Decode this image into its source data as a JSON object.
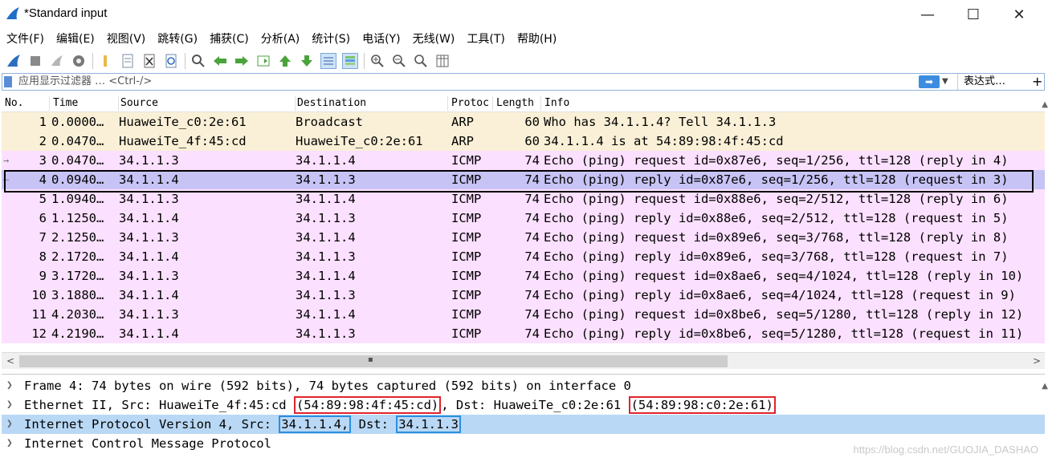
{
  "window": {
    "title": "*Standard input",
    "minimize": "—",
    "maximize": "☐",
    "close": "✕"
  },
  "menu": [
    "文件(F)",
    "编辑(E)",
    "视图(V)",
    "跳转(G)",
    "捕获(C)",
    "分析(A)",
    "统计(S)",
    "电话(Y)",
    "无线(W)",
    "工具(T)",
    "帮助(H)"
  ],
  "filter": {
    "placeholder": "应用显示过滤器 … <Ctrl-/>",
    "expression_label": "表达式…",
    "plus": "+"
  },
  "columns": {
    "no": "No.",
    "time": "Time",
    "source": "Source",
    "destination": "Destination",
    "protocol": "Protoc",
    "length": "Length",
    "info": "Info"
  },
  "colors": {
    "arp_row": "#faf0d7",
    "icmp_row": "#fce0ff",
    "selected_row": "#c7c3f5",
    "highlight_red": "#e0242b",
    "highlight_blue": "#2b8fde"
  },
  "packets": [
    {
      "no": "1",
      "time": "0.0000…",
      "src": "HuaweiTe_c0:2e:61",
      "dst": "Broadcast",
      "proto": "ARP",
      "len": "60",
      "info": "Who has 34.1.1.4? Tell 34.1.1.3",
      "marker": ""
    },
    {
      "no": "2",
      "time": "0.0470…",
      "src": "HuaweiTe_4f:45:cd",
      "dst": "HuaweiTe_c0:2e:61",
      "proto": "ARP",
      "len": "60",
      "info": "34.1.1.4 is at 54:89:98:4f:45:cd",
      "marker": ""
    },
    {
      "no": "3",
      "time": "0.0470…",
      "src": "34.1.1.3",
      "dst": "34.1.1.4",
      "proto": "ICMP",
      "len": "74",
      "info": "Echo (ping) request  id=0x87e6, seq=1/256, ttl=128 (reply in 4)",
      "marker": "→"
    },
    {
      "no": "4",
      "time": "0.0940…",
      "src": "34.1.1.4",
      "dst": "34.1.1.3",
      "proto": "ICMP",
      "len": "74",
      "info": "Echo (ping) reply    id=0x87e6, seq=1/256, ttl=128 (request in 3)",
      "marker": "—"
    },
    {
      "no": "5",
      "time": "1.0940…",
      "src": "34.1.1.3",
      "dst": "34.1.1.4",
      "proto": "ICMP",
      "len": "74",
      "info": "Echo (ping) request  id=0x88e6, seq=2/512, ttl=128 (reply in 6)",
      "marker": ""
    },
    {
      "no": "6",
      "time": "1.1250…",
      "src": "34.1.1.4",
      "dst": "34.1.1.3",
      "proto": "ICMP",
      "len": "74",
      "info": "Echo (ping) reply    id=0x88e6, seq=2/512, ttl=128 (request in 5)",
      "marker": ""
    },
    {
      "no": "7",
      "time": "2.1250…",
      "src": "34.1.1.3",
      "dst": "34.1.1.4",
      "proto": "ICMP",
      "len": "74",
      "info": "Echo (ping) request  id=0x89e6, seq=3/768, ttl=128 (reply in 8)",
      "marker": ""
    },
    {
      "no": "8",
      "time": "2.1720…",
      "src": "34.1.1.4",
      "dst": "34.1.1.3",
      "proto": "ICMP",
      "len": "74",
      "info": "Echo (ping) reply    id=0x89e6, seq=3/768, ttl=128 (request in 7)",
      "marker": ""
    },
    {
      "no": "9",
      "time": "3.1720…",
      "src": "34.1.1.3",
      "dst": "34.1.1.4",
      "proto": "ICMP",
      "len": "74",
      "info": "Echo (ping) request  id=0x8ae6, seq=4/1024, ttl=128 (reply in 10)",
      "marker": ""
    },
    {
      "no": "10",
      "time": "3.1880…",
      "src": "34.1.1.4",
      "dst": "34.1.1.3",
      "proto": "ICMP",
      "len": "74",
      "info": "Echo (ping) reply    id=0x8ae6, seq=4/1024, ttl=128 (request in 9)",
      "marker": ""
    },
    {
      "no": "11",
      "time": "4.2030…",
      "src": "34.1.1.3",
      "dst": "34.1.1.4",
      "proto": "ICMP",
      "len": "74",
      "info": "Echo (ping) request  id=0x8be6, seq=5/1280, ttl=128 (reply in 12)",
      "marker": ""
    },
    {
      "no": "12",
      "time": "4.2190…",
      "src": "34.1.1.4",
      "dst": "34.1.1.3",
      "proto": "ICMP",
      "len": "74",
      "info": "Echo (ping) reply    id=0x8be6, seq=5/1280, ttl=128 (request in 11)",
      "marker": ""
    }
  ],
  "selected_packet": "4",
  "details": {
    "frame": "Frame 4: 74 bytes on wire (592 bits), 74 bytes captured (592 bits) on interface 0",
    "eth_prefix": "Ethernet II, Src: HuaweiTe_4f:45:cd ",
    "eth_src_mac": "(54:89:98:4f:45:cd)",
    "eth_mid": ", Dst: HuaweiTe_c0:2e:61 ",
    "eth_dst_mac": "(54:89:98:c0:2e:61)",
    "ip_prefix": "Internet Protocol Version 4, Src: ",
    "ip_src": "34.1.1.4,",
    "ip_mid": " Dst: ",
    "ip_dst": "34.1.1.3",
    "icmp": "Internet Control Message Protocol"
  },
  "watermark": "https://blog.csdn.net/GUOJIA_DASHAO"
}
